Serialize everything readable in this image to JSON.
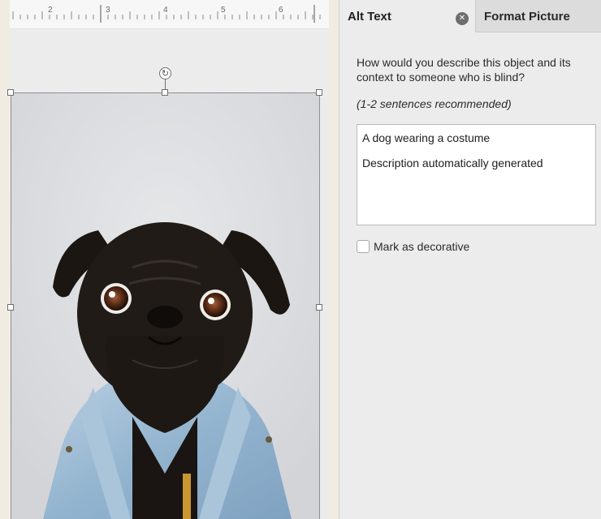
{
  "ruler": {
    "numbers": [
      "2",
      "3",
      "4",
      "5",
      "6"
    ]
  },
  "picture": {
    "subject": "pug-in-denim-jacket"
  },
  "pane": {
    "tabs": [
      {
        "label": "Alt Text",
        "active": true
      },
      {
        "label": "Format Picture",
        "active": false
      }
    ],
    "close_glyph": "✕",
    "question": "How would you describe this object and its context to someone who is blind?",
    "hint": "(1-2 sentences recommended)",
    "alt_text": {
      "line1": "A dog wearing a costume",
      "line2": "Description automatically generated"
    },
    "decorative": {
      "label": "Mark as decorative",
      "checked": false
    }
  },
  "colors": {
    "pane_bg": "#ececec",
    "tab_bar": "#dcdcdc",
    "doc_bg": "#f0ece2",
    "denim": "#9dbcd6",
    "dog": "#1e1916"
  }
}
